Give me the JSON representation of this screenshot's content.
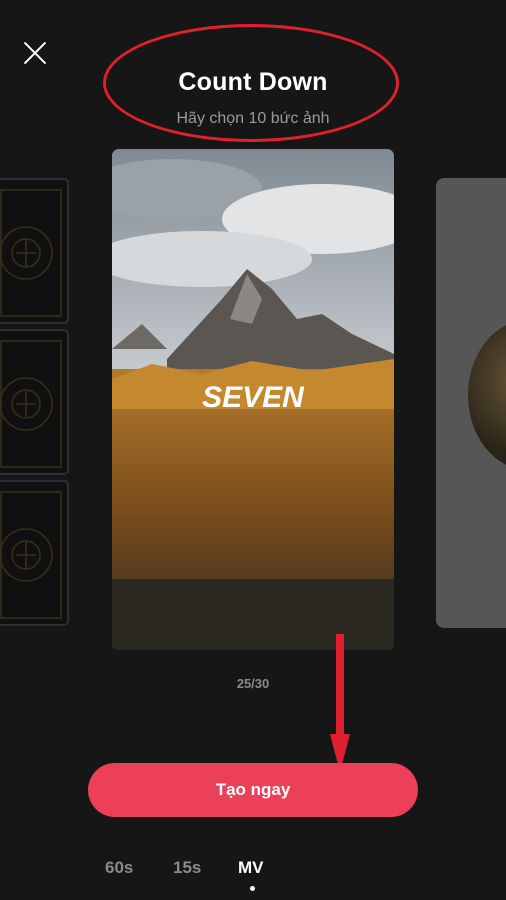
{
  "header": {
    "title": "Count Down",
    "subtitle": "Hãy chọn 10 bức ảnh"
  },
  "template": {
    "overlay_text": "SEVEN",
    "counter": "25/30"
  },
  "actions": {
    "create_label": "Tạo ngay"
  },
  "tabs": [
    {
      "label": "60s"
    },
    {
      "label": "15s"
    },
    {
      "label": "MV",
      "active": true
    }
  ],
  "colors": {
    "background": "#161616",
    "accent": "#eb4058",
    "annotation": "#e0202e"
  },
  "icons": {
    "close": "close-icon"
  }
}
